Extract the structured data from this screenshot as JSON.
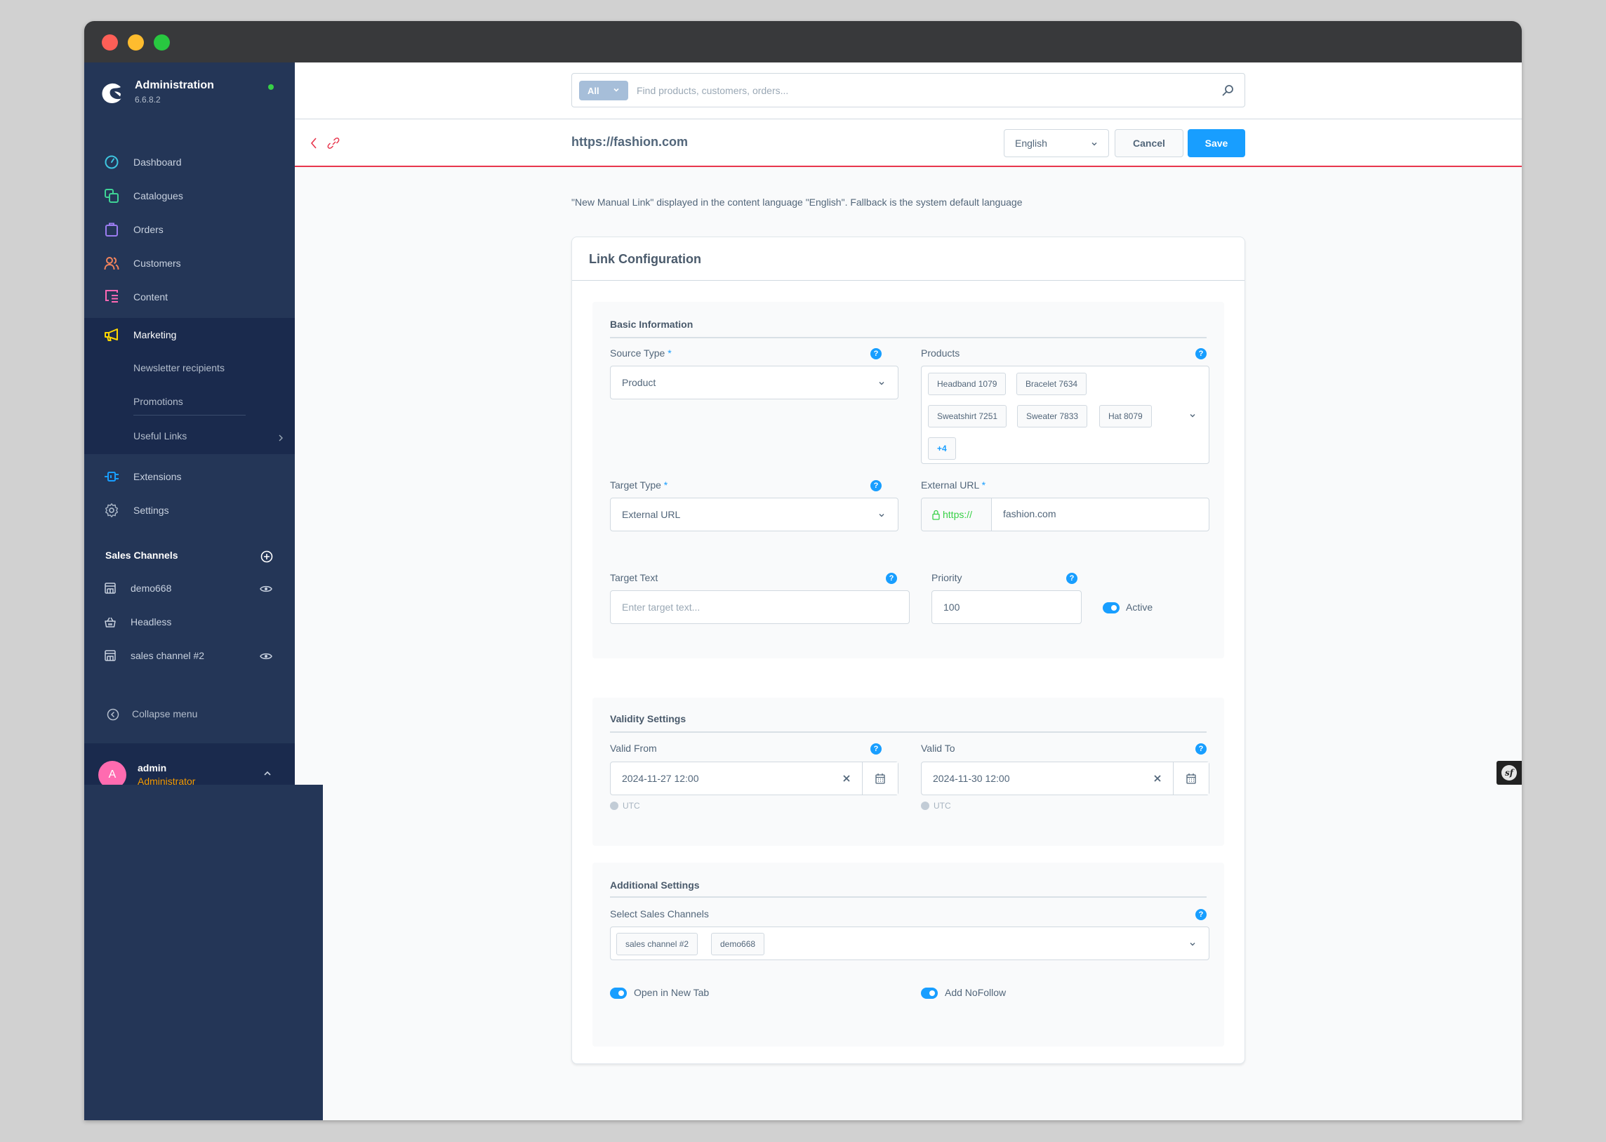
{
  "window": {
    "traffic_lights": [
      "close",
      "minimize",
      "maximize"
    ]
  },
  "brand": {
    "title": "Administration",
    "version": "6.6.8.2",
    "status_color": "#37d046"
  },
  "sidebar": {
    "items": [
      {
        "label": "Dashboard",
        "icon": "dashboard-icon",
        "color": "#3ec6e0"
      },
      {
        "label": "Catalogues",
        "icon": "catalogues-icon",
        "color": "#3fd396"
      },
      {
        "label": "Orders",
        "icon": "orders-icon",
        "color": "#9b7cf0"
      },
      {
        "label": "Customers",
        "icon": "customers-icon",
        "color": "#f2845c"
      },
      {
        "label": "Content",
        "icon": "content-icon",
        "color": "#ff68b4"
      },
      {
        "label": "Marketing",
        "icon": "marketing-icon",
        "color": "#ffd700",
        "active": true
      },
      {
        "label": "Extensions",
        "icon": "extensions-icon",
        "color": "#189eff"
      },
      {
        "label": "Settings",
        "icon": "settings-icon",
        "color": "#a6b3c4"
      }
    ],
    "marketing_children": [
      {
        "label": "Newsletter recipients"
      },
      {
        "label": "Promotions"
      },
      {
        "label": "Useful Links"
      }
    ],
    "sales_channels": {
      "title": "Sales Channels",
      "items": [
        {
          "label": "demo668",
          "icon": "storefront-icon",
          "has_eye": true
        },
        {
          "label": "Headless",
          "icon": "basket-icon",
          "has_eye": false
        },
        {
          "label": "sales channel #2",
          "icon": "storefront-icon",
          "has_eye": true
        }
      ]
    },
    "collapse_label": "Collapse menu",
    "user": {
      "initial": "A",
      "name": "admin",
      "role": "Administrator"
    }
  },
  "topbar": {
    "search_type": "All",
    "search_placeholder": "Find products, customers, orders..."
  },
  "actionbar": {
    "title": "https://fashion.com",
    "language": "English",
    "cancel_label": "Cancel",
    "save_label": "Save"
  },
  "notice": "\"New Manual Link\" displayed in the content language \"English\". Fallback is the system default language",
  "card": {
    "title": "Link Configuration",
    "basic": {
      "title": "Basic Information",
      "source_type_label": "Source Type",
      "source_type_value": "Product",
      "products_label": "Products",
      "products": [
        "Headband 1079",
        "Bracelet 7634",
        "Sweatshirt 7251",
        "Sweater 7833",
        "Hat 8079"
      ],
      "products_more": "+4",
      "target_type_label": "Target Type",
      "target_type_value": "External URL",
      "external_url_label": "External URL",
      "external_url_prefix": "https://",
      "external_url_value": "fashion.com",
      "target_text_label": "Target Text",
      "target_text_placeholder": "Enter target text...",
      "priority_label": "Priority",
      "priority_value": "100",
      "active_label": "Active",
      "active": true
    },
    "validity": {
      "title": "Validity Settings",
      "valid_from_label": "Valid From",
      "valid_from_value": "2024-11-27 12:00",
      "valid_to_label": "Valid To",
      "valid_to_value": "2024-11-30 12:00",
      "timezone": "UTC"
    },
    "additional": {
      "title": "Additional Settings",
      "sales_channels_label": "Select Sales Channels",
      "sales_channels": [
        "sales channel #2",
        "demo668"
      ],
      "open_new_tab_label": "Open in New Tab",
      "open_new_tab": true,
      "nofollow_label": "Add NoFollow",
      "nofollow": true
    }
  },
  "required_marker": "*",
  "help_glyph": "?",
  "symfony_glyph": "sf"
}
